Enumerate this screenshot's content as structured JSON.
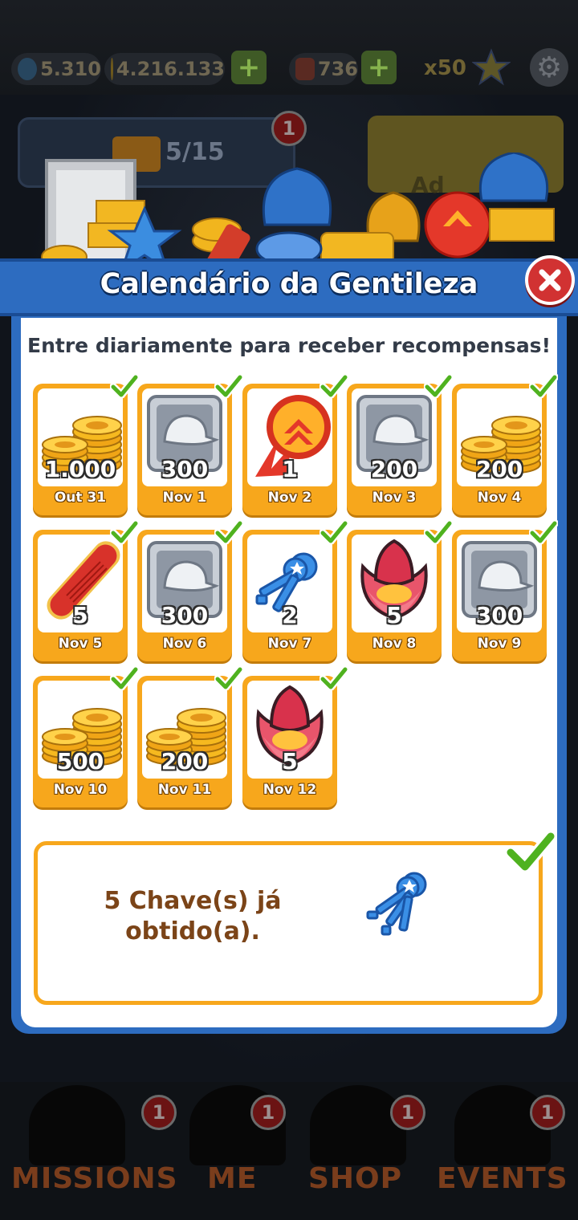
{
  "hud": {
    "keys": "5.310",
    "coins": "4.216.133",
    "boards": "736",
    "star_multiplier": "x50",
    "add_label": "+"
  },
  "background": {
    "progress": "5/15",
    "badge_count": "1",
    "ad_label": "Ad",
    "nav": [
      {
        "label": "MISSIONS",
        "badge": "1"
      },
      {
        "label": "ME",
        "badge": "1"
      },
      {
        "label": "SHOP",
        "badge": "1"
      },
      {
        "label": "EVENTS",
        "badge": "1"
      }
    ]
  },
  "modal": {
    "title": "Calendário da Gentileza",
    "subtitle": "Entre diariamente para receber recompensas!",
    "close_icon": "close-icon",
    "days": [
      {
        "date": "Out 31",
        "qty": "1.000",
        "reward": "coins",
        "claimed": true
      },
      {
        "date": "Nov 1",
        "qty": "300",
        "reward": "hat-token",
        "claimed": true
      },
      {
        "date": "Nov 2",
        "qty": "1",
        "reward": "score-booster",
        "claimed": true
      },
      {
        "date": "Nov 3",
        "qty": "200",
        "reward": "hat-token",
        "claimed": true
      },
      {
        "date": "Nov 4",
        "qty": "200",
        "reward": "coins",
        "claimed": true
      },
      {
        "date": "Nov 5",
        "qty": "5",
        "reward": "hoverboard",
        "claimed": true
      },
      {
        "date": "Nov 6",
        "qty": "300",
        "reward": "hat-token",
        "claimed": true
      },
      {
        "date": "Nov 7",
        "qty": "2",
        "reward": "keys",
        "claimed": true
      },
      {
        "date": "Nov 8",
        "qty": "5",
        "reward": "flower",
        "claimed": true
      },
      {
        "date": "Nov 9",
        "qty": "300",
        "reward": "hat-token",
        "claimed": true
      },
      {
        "date": "Nov 10",
        "qty": "500",
        "reward": "coins",
        "claimed": true
      },
      {
        "date": "Nov 11",
        "qty": "200",
        "reward": "coins",
        "claimed": true
      },
      {
        "date": "Nov 12",
        "qty": "5",
        "reward": "flower",
        "claimed": true
      }
    ],
    "summary": {
      "line1": "5 Chave(s) já",
      "line2": "obtido(a).",
      "reward": "keys",
      "claimed": true
    }
  },
  "colors": {
    "banner": "#2d6cc0",
    "card": "#f7a71c",
    "check": "#4fb21f",
    "close": "#d13232"
  }
}
